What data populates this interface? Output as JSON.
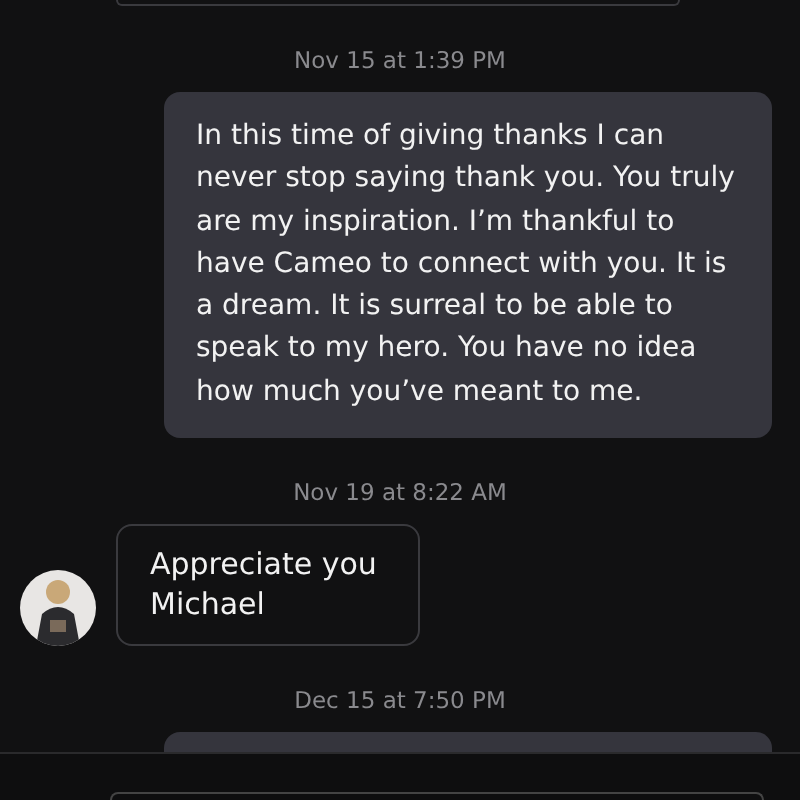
{
  "messages": [
    {
      "kind": "time",
      "text": "Nov 15 at 1:39 PM"
    },
    {
      "kind": "sent",
      "text": "In this time of giving thanks I can never stop saying thank you. You truly are my inspiration. I’m thankful to have Cameo to connect with you. It is a dream. It is surreal to be able to speak to my hero. You have no idea how much you’ve meant to me."
    },
    {
      "kind": "time",
      "text": "Nov 19 at 8:22 AM"
    },
    {
      "kind": "received",
      "text": "Appreciate you Michael"
    },
    {
      "kind": "time",
      "text": "Dec 15 at 7:50 PM"
    },
    {
      "kind": "sent"
    }
  ]
}
